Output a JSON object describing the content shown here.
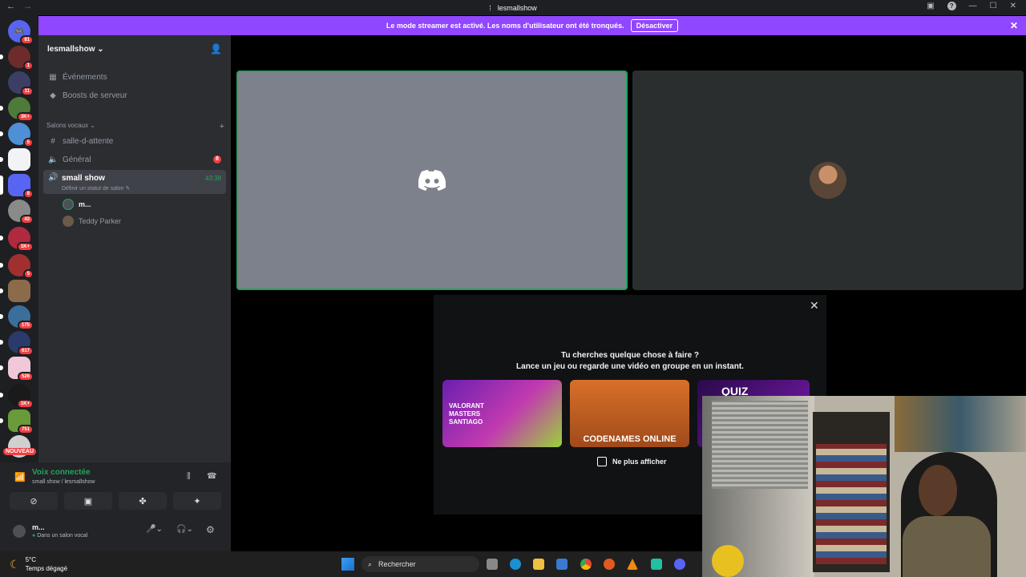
{
  "window": {
    "title": "lesmallshow"
  },
  "banner": {
    "text": "Le mode streamer est activé. Les noms d'utilisateur ont été tronqués.",
    "button": "Désactiver"
  },
  "guild_badges": [
    "81",
    "1",
    "11",
    "3K+",
    "5",
    "",
    "8",
    "43",
    "1K+",
    "5",
    "",
    "175",
    "617",
    "526",
    "1K+",
    "751"
  ],
  "new_badge": "NOUVEAU",
  "server": {
    "name": "lesmallshow"
  },
  "menu": {
    "events": "Événements",
    "boosts": "Boosts de serveur"
  },
  "category": {
    "name": "Salons vocaux"
  },
  "channels": {
    "waiting": "salle-d-attente",
    "general": "Général",
    "general_badge": "8",
    "active": "small show",
    "active_status": "Définir un statut de salon",
    "timer": "43:38"
  },
  "voice_users": [
    "m...",
    "Teddy Parker"
  ],
  "voice_panel": {
    "status": "Voix connectée",
    "location": "small show / lesmallshow"
  },
  "user": {
    "name": "m...",
    "status": "Dans un salon vocal"
  },
  "activity": {
    "line1": "Tu cherches quelque chose à faire ?",
    "line2": "Lance un jeu ou regarde une vidéo en groupe en un instant.",
    "cards": [
      "VALORANT MASTERS SANTIAGO",
      "CODENAMES ONLINE",
      "QUIZ"
    ],
    "checkbox": "Ne plus afficher"
  },
  "taskbar": {
    "search": "Rechercher",
    "temp": "5°C",
    "weather": "Temps dégagé"
  },
  "colors": {
    "accent": "#9146ff",
    "green": "#23a55a",
    "red": "#f23f43"
  }
}
